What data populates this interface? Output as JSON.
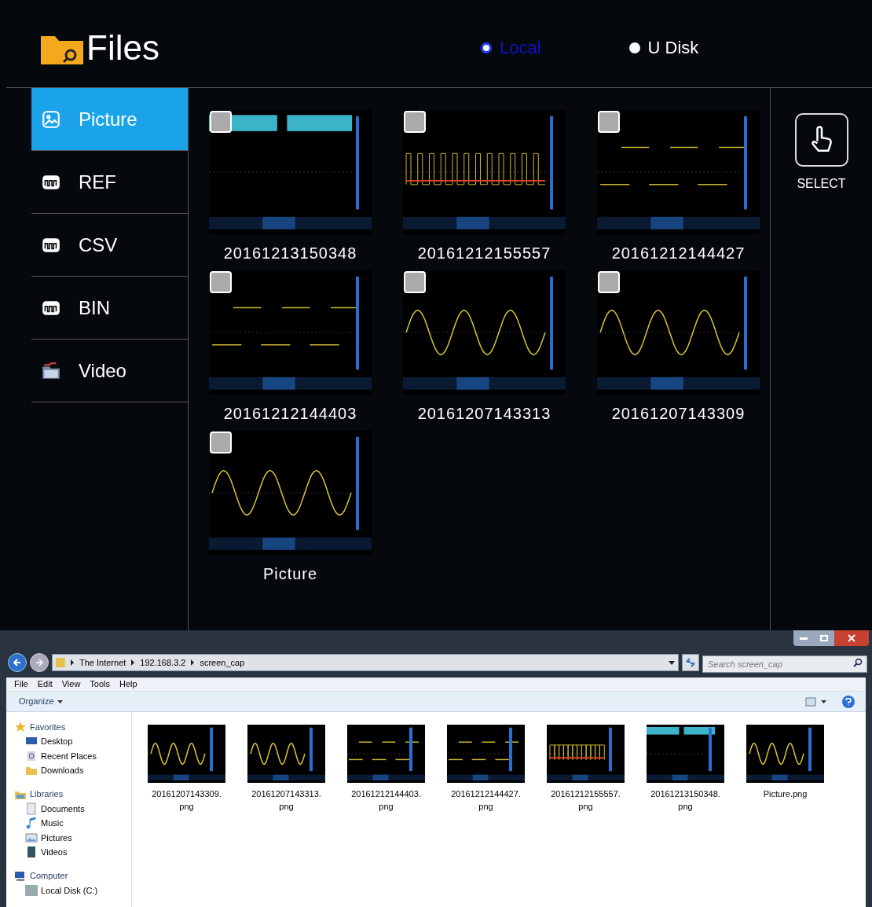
{
  "app": {
    "title": "Files",
    "sources": [
      {
        "label": "Local",
        "selected": true
      },
      {
        "label": "U Disk",
        "selected": false
      }
    ]
  },
  "sidebar": {
    "items": [
      {
        "label": "Picture",
        "kind": "picture",
        "selected": true
      },
      {
        "label": "REF",
        "kind": "wave",
        "selected": false
      },
      {
        "label": "CSV",
        "kind": "wave",
        "selected": false
      },
      {
        "label": "BIN",
        "kind": "wave",
        "selected": false
      },
      {
        "label": "Video",
        "kind": "video",
        "selected": false
      }
    ]
  },
  "files": [
    {
      "name": "20161213150348",
      "kind": "bar",
      "checked": false
    },
    {
      "name": "20161212155557",
      "kind": "pulse",
      "checked": false
    },
    {
      "name": "20161212144427",
      "kind": "square",
      "checked": false
    },
    {
      "name": "20161212144403",
      "kind": "square",
      "checked": false
    },
    {
      "name": "20161207143313",
      "kind": "sine",
      "checked": false
    },
    {
      "name": "20161207143309",
      "kind": "sine",
      "checked": false
    },
    {
      "name": "Picture",
      "kind": "sine",
      "checked": false
    }
  ],
  "select_button": {
    "label": "SELECT"
  },
  "explorer": {
    "breadcrumb": [
      "The Internet",
      "192.168.3.2",
      "screen_cap"
    ],
    "search": {
      "placeholder": "Search screen_cap"
    },
    "menu": [
      "File",
      "Edit",
      "View",
      "Tools",
      "Help"
    ],
    "toolbar": {
      "organize": "Organize"
    },
    "nav": [
      {
        "label": "Favorites",
        "kind": "star",
        "children": [
          {
            "label": "Desktop",
            "kind": "desktop"
          },
          {
            "label": "Recent Places",
            "kind": "recent"
          },
          {
            "label": "Downloads",
            "kind": "downloads"
          }
        ]
      },
      {
        "label": "Libraries",
        "kind": "library",
        "children": [
          {
            "label": "Documents",
            "kind": "documents"
          },
          {
            "label": "Music",
            "kind": "music"
          },
          {
            "label": "Pictures",
            "kind": "pictures"
          },
          {
            "label": "Videos",
            "kind": "videos"
          }
        ]
      },
      {
        "label": "Computer",
        "kind": "computer",
        "children": [
          {
            "label": "Local Disk (C:)",
            "kind": "disk"
          }
        ]
      }
    ],
    "items": [
      {
        "name": "20161207143309.",
        "ext": "png",
        "kind": "sine"
      },
      {
        "name": "20161207143313.",
        "ext": "png",
        "kind": "sine"
      },
      {
        "name": "20161212144403.",
        "ext": "png",
        "kind": "square"
      },
      {
        "name": "20161212144427.",
        "ext": "png",
        "kind": "square"
      },
      {
        "name": "20161212155557.",
        "ext": "png",
        "kind": "pulse"
      },
      {
        "name": "20161213150348.",
        "ext": "png",
        "kind": "bar"
      },
      {
        "name": "Picture.png",
        "kind": "sine"
      }
    ]
  }
}
